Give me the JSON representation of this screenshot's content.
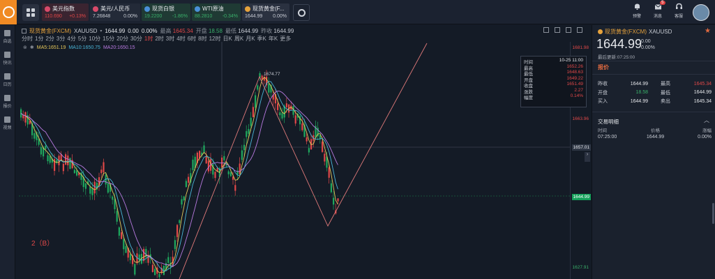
{
  "header": {
    "quotes": [
      {
        "name": "美元指数",
        "price": "110.690",
        "change": "+0.13%",
        "price_color": "#e04848",
        "change_color": "#e04848",
        "flag_color": "#d84a6a",
        "bg": "#3a2430"
      },
      {
        "name": "美元/人民币",
        "price": "7.26848",
        "change": "0.00%",
        "price_color": "#c8ccd4",
        "change_color": "#c8ccd4",
        "flag_color": "#d84a6a",
        "bg": "#232a38"
      },
      {
        "name": "现货白银",
        "price": "19.2200",
        "change": "-1.86%",
        "price_color": "#3ab06a",
        "change_color": "#3ab06a",
        "flag_color": "#4a90d8",
        "bg": "#1f3a34"
      },
      {
        "name": "WTI原油",
        "price": "88.2810",
        "change": "-0.34%",
        "price_color": "#3ab06a",
        "change_color": "#3ab06a",
        "flag_color": "#4a90d8",
        "bg": "#1f3a34"
      },
      {
        "name": "现货黄金(F...",
        "price": "1644.99",
        "change": "0.00%",
        "price_color": "#c8ccd4",
        "change_color": "#c8ccd4",
        "flag_color": "#e6a23c",
        "bg": "#2a3140"
      }
    ],
    "right": {
      "alert_label": "预警",
      "message_label": "消息",
      "message_badge": "5",
      "service_label": "客服"
    }
  },
  "sidebar": {
    "items": [
      {
        "label": "自选",
        "icon": "bookmark-icon"
      },
      {
        "label": "快讯",
        "icon": "news-icon"
      },
      {
        "label": "日历",
        "icon": "calendar-icon"
      },
      {
        "label": "报价",
        "icon": "quote-icon"
      },
      {
        "label": "视频",
        "icon": "video-icon"
      }
    ]
  },
  "chart": {
    "title": "现货黄金(FXCM)",
    "symbol": "XAUUSD",
    "price": "1644.99",
    "change": "0.00",
    "change_pct": "0.00%",
    "stats": [
      {
        "k": "最高",
        "v": "1645.34",
        "color": "red"
      },
      {
        "k": "开盘",
        "v": "18.58",
        "color": "green"
      },
      {
        "k": "最低",
        "v": "1644.99",
        "color": ""
      },
      {
        "k": "昨收",
        "v": "1644.99",
        "color": ""
      }
    ],
    "periods": [
      "分时",
      "1分",
      "2分",
      "3分",
      "4分",
      "5分",
      "10分",
      "15分",
      "20分",
      "30分",
      "1时",
      "2时",
      "3时",
      "4时",
      "6时",
      "8时",
      "12时",
      "日K",
      "周K",
      "月K",
      "季K",
      "年K",
      "更多"
    ],
    "active_period": "1时",
    "ma": {
      "ma5": "MA5:1651.19",
      "ma10": "MA10:1650.75",
      "ma20": "MA20:1650.15"
    },
    "y_labels": [
      {
        "text": "1681.98",
        "type": "red"
      },
      {
        "text": "1663.96",
        "type": "red"
      },
      {
        "text": "1657.01",
        "type": "box"
      },
      {
        "text": "1644.99",
        "type": "greenbox"
      },
      {
        "text": "1627.91",
        "type": "green"
      }
    ],
    "tooltip": [
      {
        "k": "时间",
        "v": "10-25 11:00",
        "color": ""
      },
      {
        "k": "最高",
        "v": "1652.26",
        "color": "red"
      },
      {
        "k": "最低",
        "v": "1648.63",
        "color": "red"
      },
      {
        "k": "开盘",
        "v": "1649.22",
        "color": "red"
      },
      {
        "k": "收盘",
        "v": "1651.49",
        "color": "red"
      },
      {
        "k": "涨跌",
        "v": "2.27",
        "color": "red"
      },
      {
        "k": "幅度",
        "v": "0.14%",
        "color": "red"
      }
    ],
    "peak_label": "1674.77",
    "wave_label": "2（B）"
  },
  "panel": {
    "title": "现货黄金(FXCM)",
    "symbol": "XAUUSD",
    "price": "1644.99",
    "change": "0.00",
    "change_pct": "0.00%",
    "update_time": "最后更新:07:25:00",
    "section": "报价",
    "quote_rows": [
      {
        "l1": "昨收",
        "v1": "1644.99",
        "c1": "",
        "l2": "最高",
        "v2": "1645.34",
        "c2": "red"
      },
      {
        "l1": "开盘",
        "v1": "18.58",
        "c1": "green",
        "l2": "最低",
        "v2": "1644.99",
        "c2": ""
      },
      {
        "l1": "买入",
        "v1": "1644.99",
        "c1": "",
        "l2": "卖出",
        "v2": "1645.34",
        "c2": ""
      }
    ],
    "tx_title": "交易明细",
    "tx_head": [
      "时间",
      "价格",
      "涨幅"
    ],
    "tx_rows": [
      [
        "07:25:00",
        "1644.99",
        "0.00%"
      ]
    ]
  }
}
